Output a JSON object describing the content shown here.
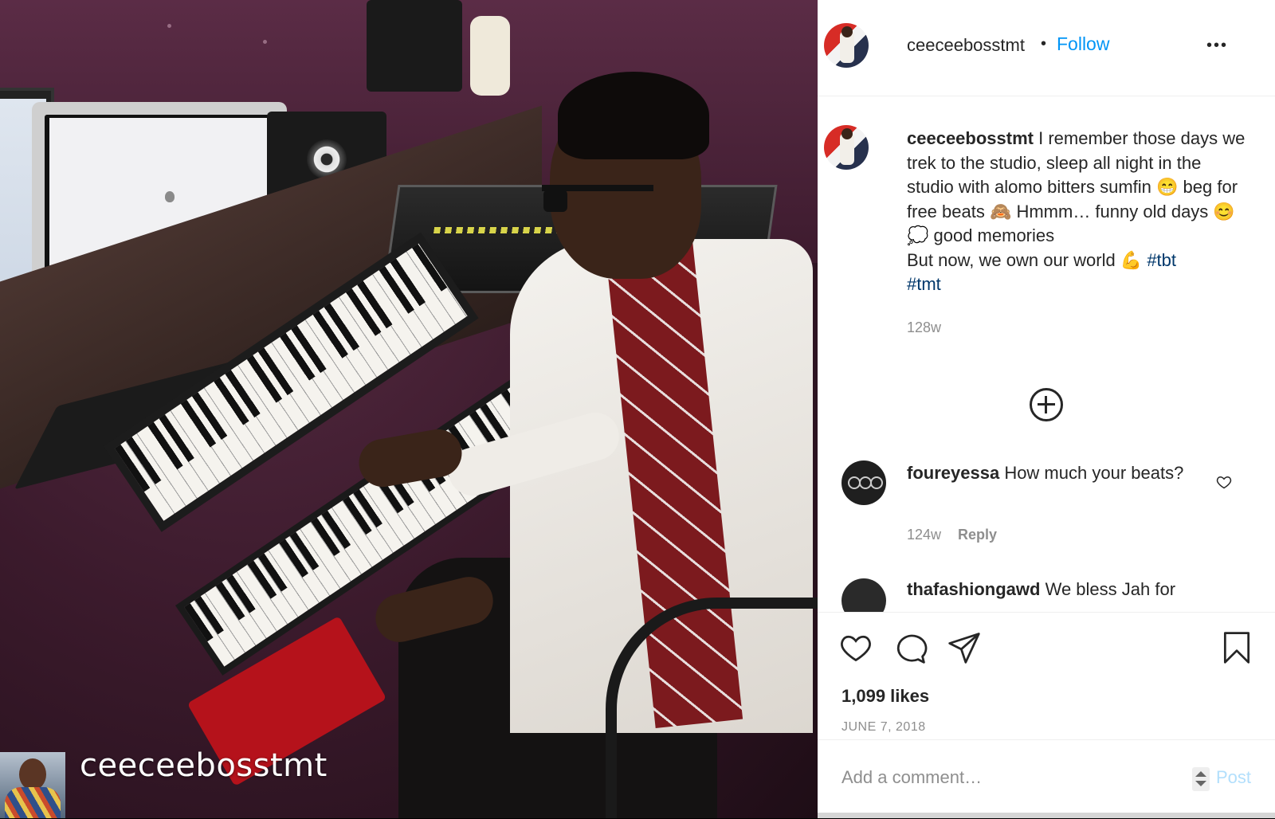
{
  "post": {
    "author": "ceeceebosstmt",
    "follow_label": "Follow",
    "separator": "•",
    "more_label": "•••",
    "watermark": "ceeceebosstmt"
  },
  "caption": {
    "username": "ceeceebosstmt",
    "text_1": "I remember those days we trek to the studio, sleep all night in the studio with alomo bitters sumfin 😁 beg for free beats 🙈 Hmmm… funny old days 😊 💭 good memories",
    "text_2": "But now, we own our world 💪 ",
    "tag_1": "#tbt",
    "tag_2": "#tmt",
    "timestamp": "128w"
  },
  "comments": [
    {
      "username": "foureyessa",
      "text": "How much your beats?",
      "timestamp": "124w",
      "reply_label": "Reply"
    },
    {
      "username": "thafashiongawd",
      "text": "We bless Jah for"
    }
  ],
  "actions": {
    "likes": "1,099 likes",
    "date": "JUNE 7, 2018"
  },
  "comment_box": {
    "placeholder": "Add a comment…",
    "post_label": "Post"
  },
  "colors": {
    "link": "#0095f6",
    "hashtag": "#00376b",
    "muted": "#8e8e8e",
    "post_disabled": "#b2dffc"
  },
  "icons": [
    "more-icon",
    "add-comments-icon",
    "heart-icon",
    "comment-icon",
    "share-icon",
    "save-icon",
    "comment-like-icon"
  ]
}
